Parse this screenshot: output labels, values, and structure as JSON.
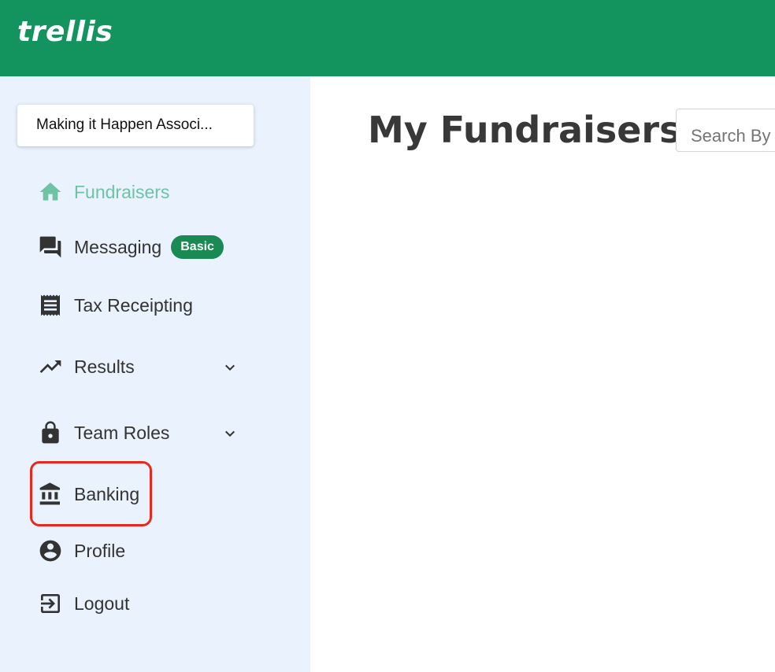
{
  "brand": {
    "logo_text": "trellis",
    "color": "#13945f"
  },
  "org_selector": {
    "value": "Making it Happen Associ..."
  },
  "sidebar": {
    "items": [
      {
        "label": "Fundraisers",
        "icon": "home-icon",
        "active": true
      },
      {
        "label": "Messaging",
        "icon": "forum-icon",
        "badge": "Basic"
      },
      {
        "label": "Tax Receipting",
        "icon": "receipt-icon"
      },
      {
        "label": "Results",
        "icon": "trending-up-icon",
        "expandable": true
      },
      {
        "label": "Team Roles",
        "icon": "lock-icon",
        "expandable": true
      },
      {
        "label": "Banking",
        "icon": "bank-icon",
        "highlighted": true
      },
      {
        "label": "Profile",
        "icon": "account-circle-icon"
      },
      {
        "label": "Logout",
        "icon": "logout-icon"
      }
    ]
  },
  "main": {
    "title": "My Fundraisers",
    "search": {
      "placeholder": "Search By"
    }
  },
  "colors": {
    "active": "#6dc3a4",
    "badge": "#1a8a55",
    "highlight": "#e8281f",
    "sidebar_bg": "#e9f2fd"
  }
}
